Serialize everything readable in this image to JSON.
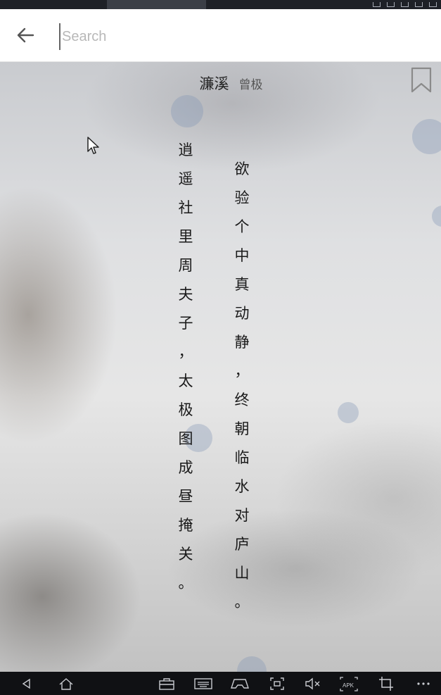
{
  "search": {
    "placeholder": "Search",
    "value": ""
  },
  "poem": {
    "title": "濂溪",
    "author": "曾极",
    "lines": [
      [
        "逍",
        "遥",
        "社",
        "里",
        "周",
        "夫",
        "子",
        "，",
        "太",
        "极",
        "图",
        "成",
        "昼",
        "掩",
        "关",
        "。"
      ],
      [
        "欲",
        "验",
        "个",
        "中",
        "真",
        "动",
        "静",
        "，",
        "终",
        "朝",
        "临",
        "水",
        "对",
        "庐",
        "山",
        "。"
      ]
    ]
  },
  "icons": {
    "back": "arrow-left-icon",
    "bookmark": "bookmark-icon"
  },
  "colors": {
    "search_bar_bg": "#ffffff",
    "placeholder": "#b8b8b8",
    "text": "#1a1a1a",
    "nav_bar_bg": "#101114"
  },
  "nav_bar": {
    "items": [
      "back-triangle-icon",
      "home-icon",
      "toolbox-icon",
      "keyboard-icon",
      "gamepad-icon",
      "screenshot-icon",
      "volume-mute-icon",
      "apk-install-icon",
      "crop-icon",
      "more-icon"
    ]
  }
}
